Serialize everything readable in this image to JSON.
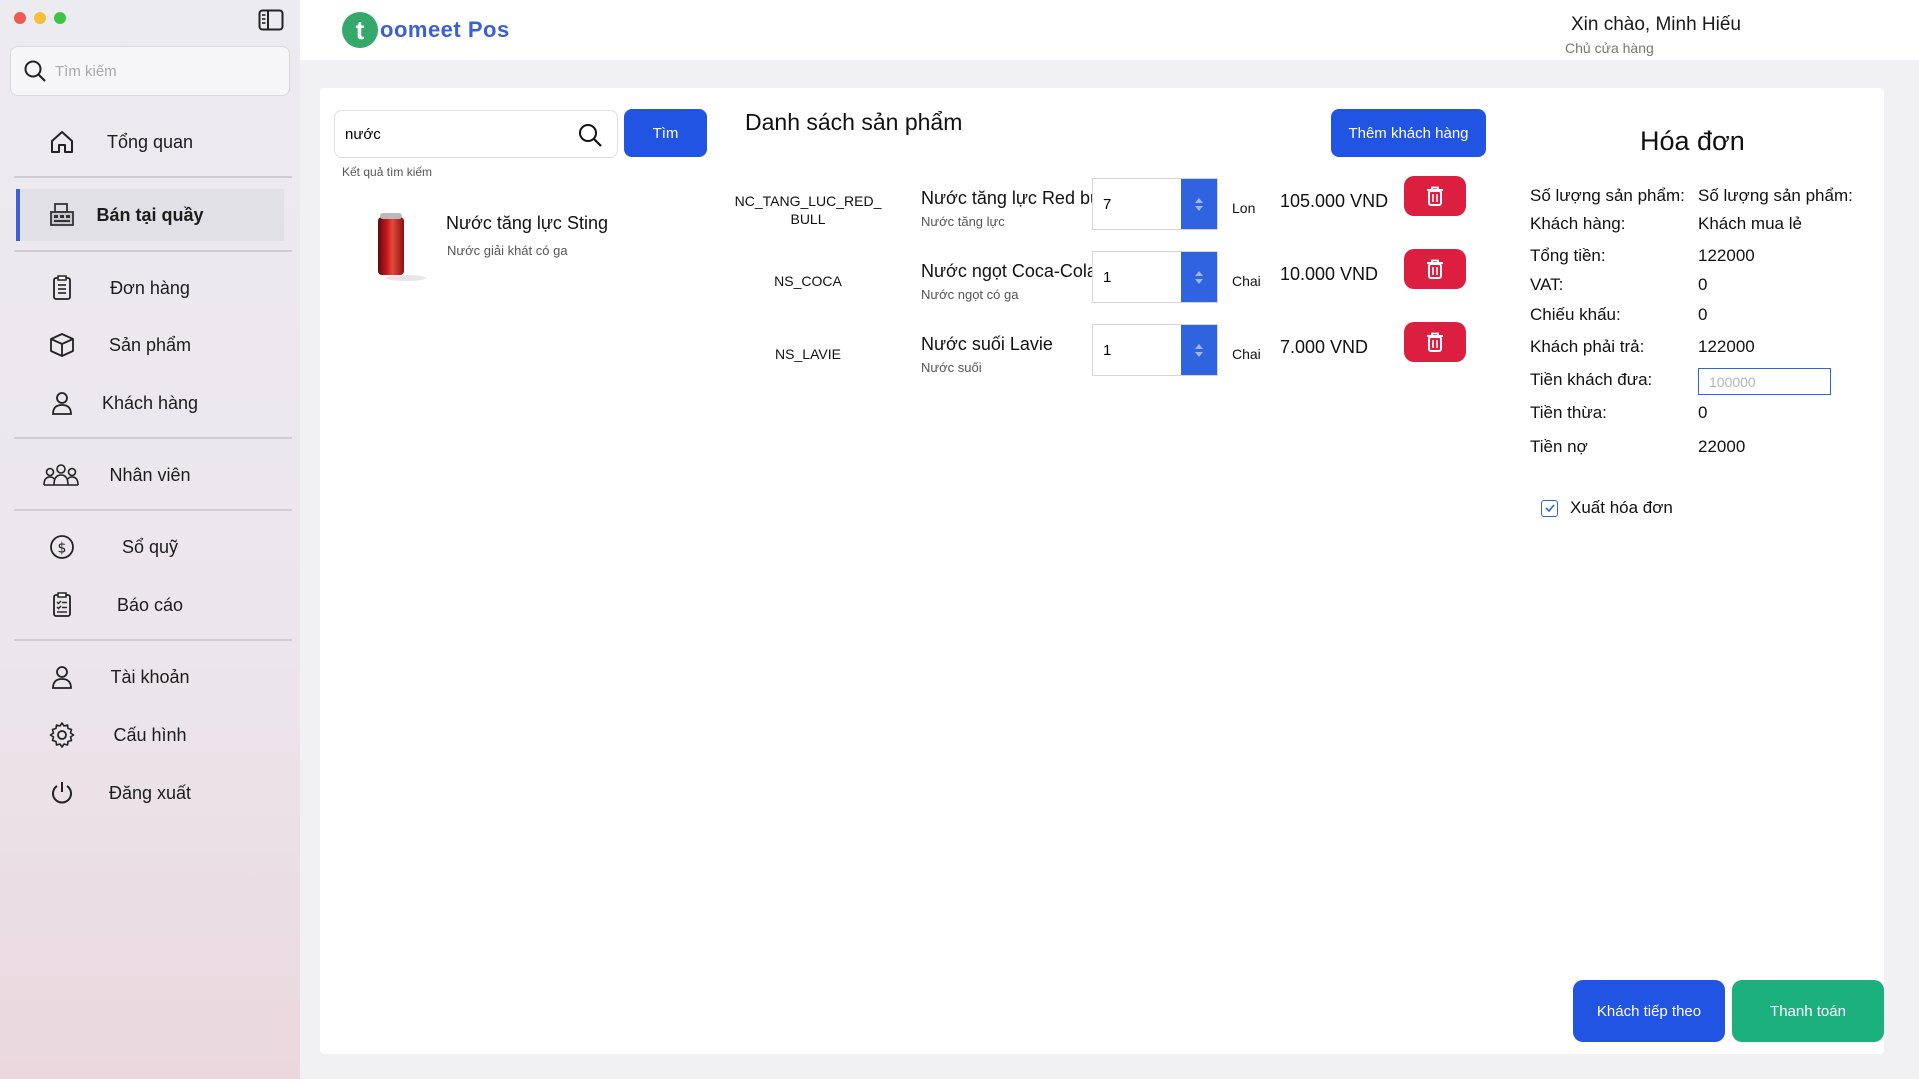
{
  "sidebar": {
    "search_placeholder": "Tìm kiếm",
    "items": [
      {
        "label": "Tổng quan",
        "icon": "home-icon"
      },
      {
        "label": "Bán tại quầy",
        "icon": "cash-register-icon"
      },
      {
        "label": "Đơn hàng",
        "icon": "clipboard-list-icon"
      },
      {
        "label": "Sản phẩm",
        "icon": "box-icon"
      },
      {
        "label": "Khách hàng",
        "icon": "user-icon"
      },
      {
        "label": "Nhân viên",
        "icon": "team-icon"
      },
      {
        "label": "Sổ quỹ",
        "icon": "dollar-circle-icon"
      },
      {
        "label": "Báo cáo",
        "icon": "report-icon"
      },
      {
        "label": "Tài khoản",
        "icon": "account-icon"
      },
      {
        "label": "Cấu hình",
        "icon": "gear-icon"
      },
      {
        "label": "Đăng xuất",
        "icon": "power-icon"
      }
    ],
    "active_index": 1,
    "colors": {
      "accent": "#3a5fd6"
    }
  },
  "header": {
    "logo_letter": "t",
    "logo_text": "oomeet Pos",
    "greeting": "Xin chào, Minh Hiếu",
    "role": "Chủ cửa hàng"
  },
  "search": {
    "value": "nước",
    "button_label": "Tìm",
    "result_label": "Kết quả tìm kiếm",
    "results": [
      {
        "name": "Nước tăng lực Sting",
        "desc": "Nước giải khát có ga"
      }
    ]
  },
  "product_list": {
    "title": "Danh sách sản phẩm",
    "add_customer_label": "Thêm khách hàng",
    "rows": [
      {
        "code": "NC_TANG_LUC_RED_BULL",
        "name": "Nước tăng lực Red bull",
        "desc": "Nước tăng lực",
        "qty": "7",
        "unit": "Lon",
        "price": "105.000 VND"
      },
      {
        "code": "NS_COCA",
        "name": "Nước ngọt Coca-Cola",
        "desc": "Nước ngọt có ga",
        "qty": "1",
        "unit": "Chai",
        "price": "10.000 VND"
      },
      {
        "code": "NS_LAVIE",
        "name": "Nước suối Lavie",
        "desc": "Nước suối",
        "qty": "1",
        "unit": "Chai",
        "price": "7.000 VND"
      }
    ]
  },
  "invoice": {
    "title": "Hóa đơn",
    "rows": [
      {
        "key": "Số lượng sản phẩm:",
        "value": "Số lượng sản phẩm:"
      },
      {
        "key": "Khách hàng:",
        "value": "Khách mua lẻ"
      },
      {
        "key": "Tổng tiền:",
        "value": "122000"
      },
      {
        "key": "VAT:",
        "value": "0"
      },
      {
        "key": "Chiếu khấu:",
        "value": "0"
      },
      {
        "key": "Khách phải trả:",
        "value": "122000"
      },
      {
        "key": "Tiền khách đưa:",
        "value": ""
      },
      {
        "key": "Tiền thừa:",
        "value": "0"
      },
      {
        "key": "Tiền nợ",
        "value": "22000"
      }
    ],
    "paid_placeholder": "100000",
    "export_label": "Xuất hóa đơn",
    "export_checked": true
  },
  "footer": {
    "next_customer_label": "Khách tiếp theo",
    "pay_label": "Thanh toán"
  },
  "colors": {
    "primary_blue": "#2154e3",
    "delete_red": "#dc1e40",
    "pay_green": "#1db07f"
  }
}
